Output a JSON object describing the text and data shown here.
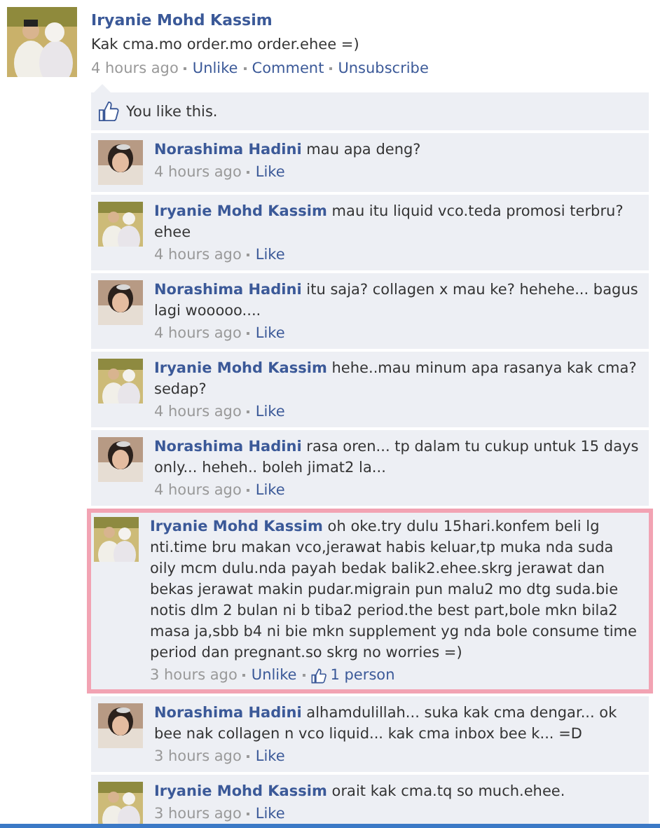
{
  "post": {
    "author": "Iryanie Mohd Kassim",
    "text": "Kak cma.mo order.mo order.ehee =)",
    "time": "4 hours ago",
    "actions": [
      "Unlike",
      "Comment",
      "Unsubscribe"
    ],
    "avatar": {
      "kind": "couple"
    }
  },
  "likes": {
    "text": "You like this."
  },
  "comments": [
    {
      "author": "Norashima Hadini",
      "text": "mau apa deng?",
      "time": "4 hours ago",
      "actions": [
        "Like"
      ],
      "highlighted": false,
      "avatar": {
        "kind": "portrait"
      }
    },
    {
      "author": "Iryanie Mohd Kassim",
      "text": "mau itu liquid vco.teda promosi terbru? ehee",
      "time": "4 hours ago",
      "actions": [
        "Like"
      ],
      "highlighted": false,
      "avatar": {
        "kind": "couple"
      }
    },
    {
      "author": "Norashima Hadini",
      "text": "itu saja? collagen x mau ke? hehehe... bagus lagi wooooo....",
      "time": "4 hours ago",
      "actions": [
        "Like"
      ],
      "highlighted": false,
      "avatar": {
        "kind": "portrait"
      }
    },
    {
      "author": "Iryanie Mohd Kassim",
      "text": "hehe..mau minum apa rasanya kak cma? sedap?",
      "time": "4 hours ago",
      "actions": [
        "Like"
      ],
      "highlighted": false,
      "avatar": {
        "kind": "couple"
      }
    },
    {
      "author": "Norashima Hadini",
      "text": "rasa oren... tp dalam tu cukup untuk 15 days only... heheh.. boleh jimat2 la...",
      "time": "4 hours ago",
      "actions": [
        "Like"
      ],
      "highlighted": false,
      "avatar": {
        "kind": "portrait"
      }
    },
    {
      "author": "Iryanie Mohd Kassim",
      "text": "oh oke.try dulu 15hari.konfem beli lg nti.time bru makan vco,jerawat habis keluar,tp muka nda suda oily mcm dulu.nda payah bedak balik2.ehee.skrg jerawat dan bekas jerawat makin pudar.migrain pun malu2 mo dtg suda.bie notis dlm 2 bulan ni b tiba2 period.the best part,bole mkn bila2 masa ja,sbb b4 ni bie mkn supplement yg nda bole consume time period dan pregnant.so skrg no worries =)",
      "time": "3 hours ago",
      "actions": [
        "Unlike"
      ],
      "like_count": "1 person",
      "highlighted": true,
      "avatar": {
        "kind": "couple"
      }
    },
    {
      "author": "Norashima Hadini",
      "text": "alhamdulillah... suka kak cma dengar... ok bee nak collagen n vco liquid... kak cma inbox bee k... =D",
      "time": "3 hours ago",
      "actions": [
        "Like"
      ],
      "highlighted": false,
      "avatar": {
        "kind": "portrait"
      }
    },
    {
      "author": "Iryanie Mohd Kassim",
      "text": "orait kak cma.tq so much.ehee.",
      "time": "3 hours ago",
      "actions": [
        "Like"
      ],
      "highlighted": false,
      "avatar": {
        "kind": "couple"
      }
    }
  ]
}
